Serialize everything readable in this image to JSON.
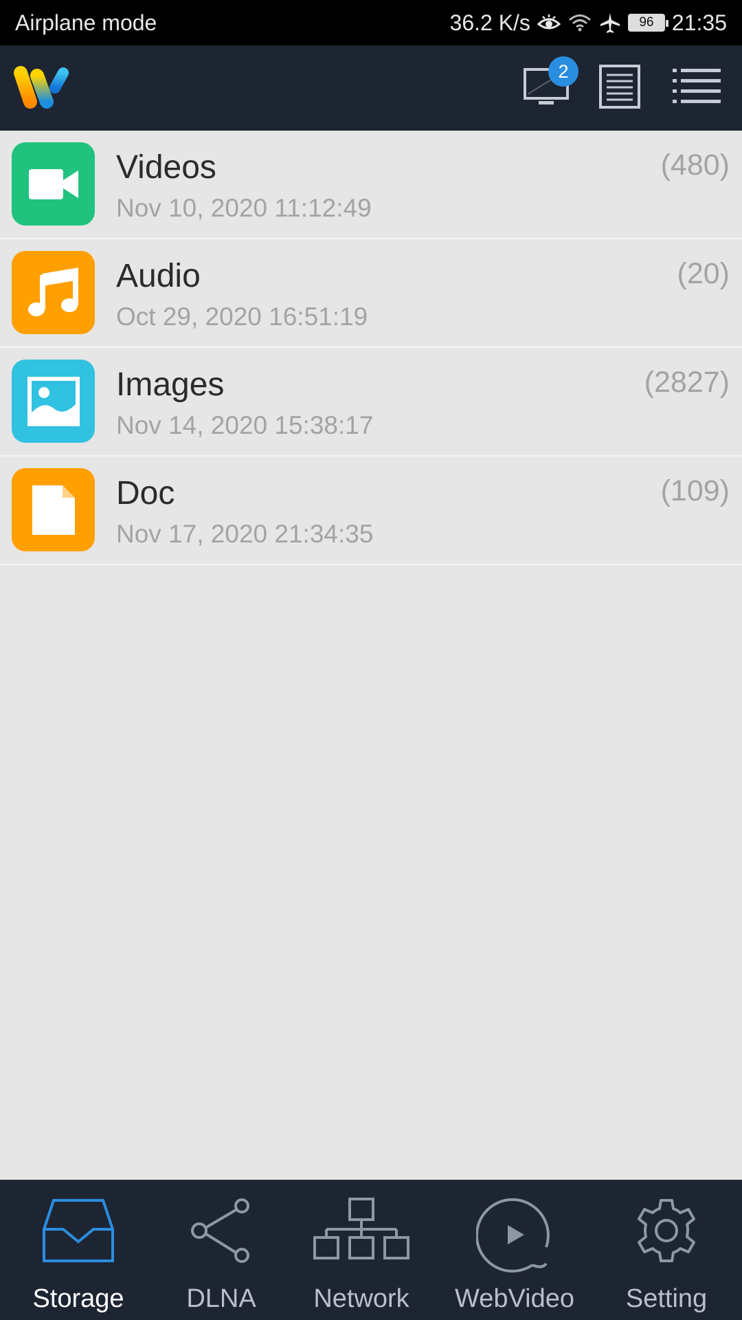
{
  "status_bar": {
    "left_text": "Airplane mode",
    "speed": "36.2 K/s",
    "battery": "96",
    "time": "21:35",
    "icons": [
      "eye-icon",
      "wifi-icon",
      "airplane-icon",
      "battery-icon"
    ]
  },
  "app_bar": {
    "logo": "app-logo",
    "devices_badge": "2",
    "icons": [
      "devices-icon",
      "log-icon",
      "menu-icon"
    ]
  },
  "colors": {
    "app_bar": "#1e2532",
    "background": "#e6e6e6",
    "videos": "#1fc37d",
    "audio": "#ff9f00",
    "images": "#31c1e1",
    "doc": "#ff9f00",
    "accent": "#2a8ee0"
  },
  "items": [
    {
      "title": "Videos",
      "date": "Nov 10, 2020 11:12:49",
      "count": "(480)",
      "icon": "video-camera-icon"
    },
    {
      "title": "Audio",
      "date": "Oct 29, 2020 16:51:19",
      "count": "(20)",
      "icon": "music-note-icon"
    },
    {
      "title": "Images",
      "date": "Nov 14, 2020 15:38:17",
      "count": "(2827)",
      "icon": "image-icon"
    },
    {
      "title": "Doc",
      "date": "Nov 17, 2020 21:34:35",
      "count": "(109)",
      "icon": "document-icon"
    }
  ],
  "nav": [
    {
      "label": "Storage",
      "icon": "storage-tray-icon",
      "active": true
    },
    {
      "label": "DLNA",
      "icon": "share-icon",
      "active": false
    },
    {
      "label": "Network",
      "icon": "network-icon",
      "active": false
    },
    {
      "label": "WebVideo",
      "icon": "play-circle-icon",
      "active": false
    },
    {
      "label": "Setting",
      "icon": "gear-icon",
      "active": false
    }
  ]
}
